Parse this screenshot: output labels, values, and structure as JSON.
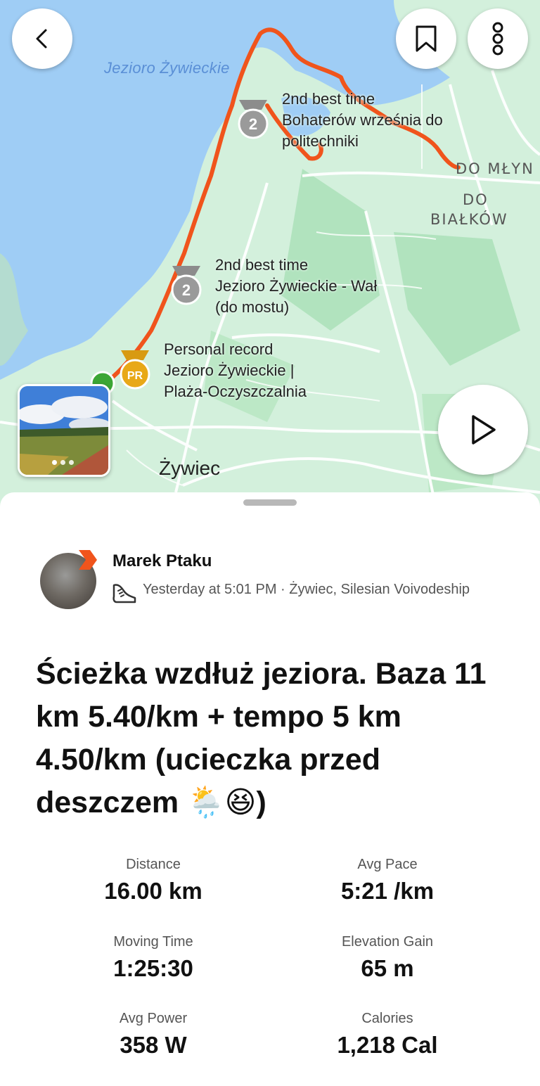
{
  "map": {
    "lake_label": "Jezioro Żywieckie",
    "place_labels": [
      "DO MŁYN",
      "DO",
      "BIAŁKÓW"
    ],
    "town_label": "Żywiec",
    "segments": [
      {
        "badge": "2",
        "lines": [
          "2nd best time",
          "Bohaterów września do",
          "politechniki"
        ]
      },
      {
        "badge": "2",
        "lines": [
          "2nd best time",
          "Jezioro Żywieckie - Wał",
          "(do mostu)"
        ]
      },
      {
        "badge": "PR",
        "lines": [
          "Personal record",
          "Jezioro Żywieckie |",
          "Plaża-Oczyszczalnia"
        ]
      }
    ],
    "route_color": "#f0541c",
    "water_color": "#9fcdf5",
    "land_color": "#cfeedd"
  },
  "controls": {
    "back": "chevron-left-icon",
    "bookmark": "bookmark-icon",
    "more": "more-vertical-icon",
    "play": "play-icon"
  },
  "athlete": {
    "name": "Marek Ptaku",
    "meta": "Yesterday at 5:01 PM · Żywiec, Silesian Voivodeship",
    "activity_icon": "running-shoe-icon"
  },
  "activity": {
    "title": "Ścieżka wzdłuż jeziora. Baza 11 km 5.40/km + tempo 5 km 4.50/km (ucieczka przed deszczem 🌦️😆)"
  },
  "stats": [
    {
      "label": "Distance",
      "value": "16.00 km"
    },
    {
      "label": "Avg Pace",
      "value": "5:21 /km"
    },
    {
      "label": "Moving Time",
      "value": "1:25:30"
    },
    {
      "label": "Elevation Gain",
      "value": "65 m"
    },
    {
      "label": "Avg Power",
      "value": "358 W"
    },
    {
      "label": "Calories",
      "value": "1,218 Cal"
    }
  ]
}
